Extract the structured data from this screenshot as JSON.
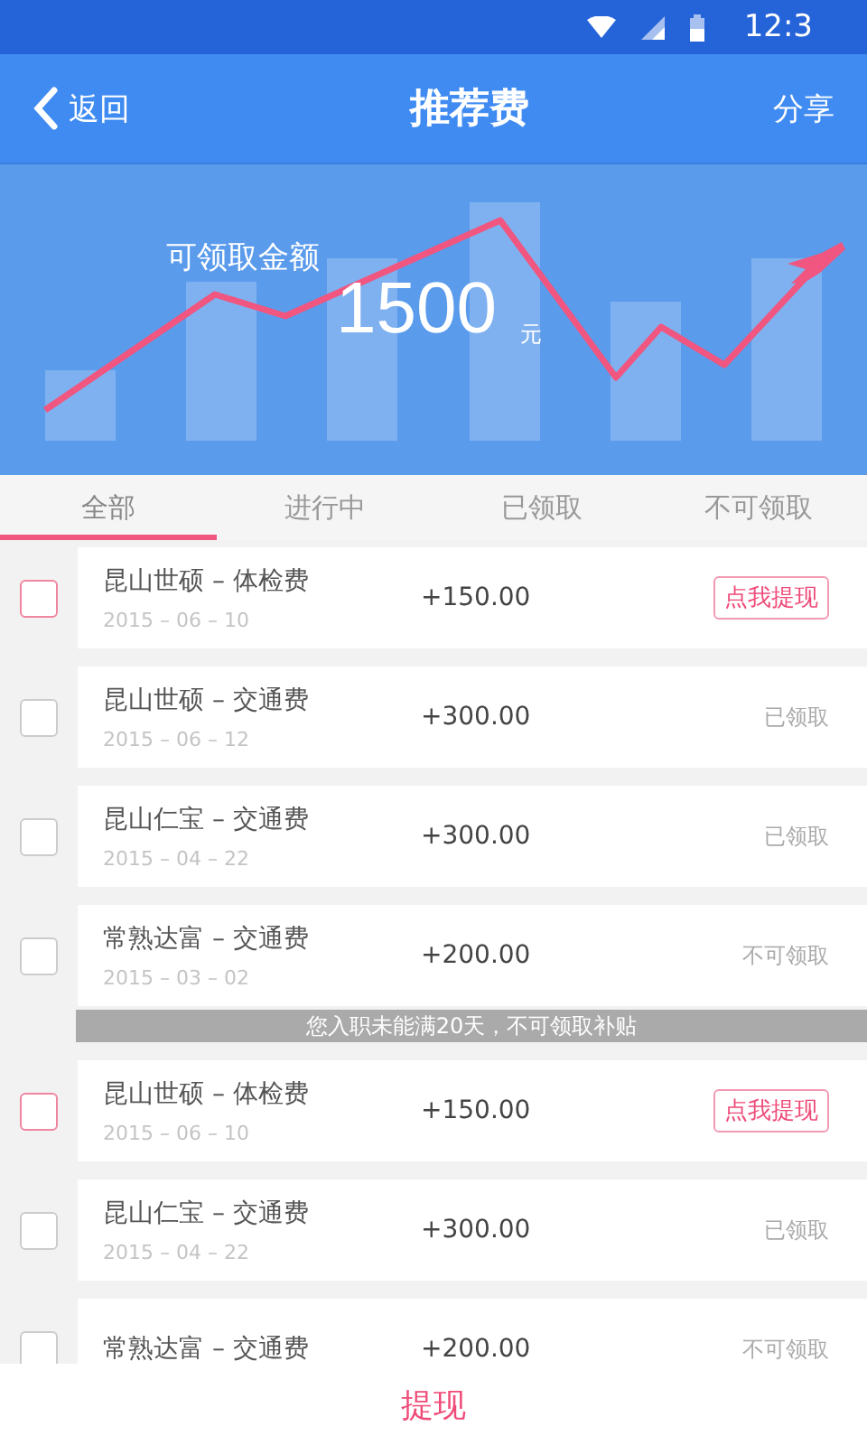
{
  "status_bar": {
    "time": "12:3"
  },
  "header": {
    "back": "返回",
    "title": "推荐费",
    "action": "分享"
  },
  "summary": {
    "label": "可领取金额",
    "amount": "1500",
    "unit": "元"
  },
  "tabs": [
    {
      "label": "全部",
      "selected": true
    },
    {
      "label": "进行中",
      "selected": false
    },
    {
      "label": "已领取",
      "selected": false
    },
    {
      "label": "不可领取",
      "selected": false
    }
  ],
  "list": [
    {
      "kind": "record",
      "checked": false,
      "name": "昆山世硕 – 体检费",
      "date": "2015 – 06 – 10",
      "amount": "+150.00",
      "status": {
        "kind": "button",
        "text": "点我提现"
      }
    },
    {
      "kind": "record",
      "checked": false,
      "name": "昆山世硕 – 交通费",
      "date": "2015 – 06 – 12",
      "amount": "+300.00",
      "status": {
        "kind": "label",
        "text": "已领取"
      }
    },
    {
      "kind": "record",
      "checked": false,
      "name": "昆山仁宝 – 交通费",
      "date": "2015 – 04 – 22",
      "amount": "+300.00",
      "status": {
        "kind": "label",
        "text": "已领取"
      }
    },
    {
      "kind": "record",
      "checked": false,
      "name": "常熟达富 – 交通费",
      "date": "2015 – 03 – 02",
      "amount": "+200.00",
      "status": {
        "kind": "label",
        "text": "不可领取"
      }
    },
    {
      "kind": "notice",
      "text": "您入职未能满20天，不可领取补贴"
    },
    {
      "kind": "record",
      "checked": false,
      "name": "昆山世硕 – 体检费",
      "date": "2015 – 06 – 10",
      "amount": "+150.00",
      "status": {
        "kind": "button",
        "text": "点我提现"
      }
    },
    {
      "kind": "record",
      "checked": false,
      "name": "昆山仁宝 – 交通费",
      "date": "2015 – 04 – 22",
      "amount": "+300.00",
      "status": {
        "kind": "label",
        "text": "已领取"
      }
    },
    {
      "kind": "record",
      "checked": false,
      "name": "常熟达富 – 交通费",
      "amount": "+200.00",
      "status": {
        "kind": "label",
        "text": "不可领取"
      }
    }
  ],
  "submit": "提现"
}
